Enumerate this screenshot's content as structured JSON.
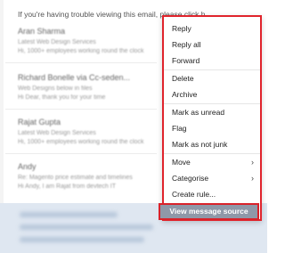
{
  "background": {
    "trouble_text": "If you're having trouble viewing this email, please click h",
    "emails": [
      {
        "from": "Aran Sharma",
        "lines": [
          "Latest Web Design Services",
          "Hi, 1000+ employees working round the clock"
        ]
      },
      {
        "from": "Richard Bonelle via Cc-seden...",
        "lines": [
          "Web Designs below in files",
          "Hi Dear, thank you for your time"
        ]
      },
      {
        "from": "Rajat Gupta",
        "lines": [
          "Latest Web Design Services",
          "Hi, 1000+ employees working round the clock"
        ]
      },
      {
        "from": "Andy",
        "lines": [
          "Re: Magento price estimate and timelines",
          "Hi Andy, I am Rajat from devtech IT"
        ]
      }
    ]
  },
  "menu": {
    "items": [
      {
        "label": "Reply",
        "submenu": false
      },
      {
        "label": "Reply all",
        "submenu": false
      },
      {
        "label": "Forward",
        "submenu": false
      },
      {
        "label": "Delete",
        "submenu": false
      },
      {
        "label": "Archive",
        "submenu": false
      },
      {
        "label": "Mark as unread",
        "submenu": false
      },
      {
        "label": "Flag",
        "submenu": false
      },
      {
        "label": "Mark as not junk",
        "submenu": false
      },
      {
        "label": "Move",
        "submenu": true
      },
      {
        "label": "Categorise",
        "submenu": true
      },
      {
        "label": "Create rule...",
        "submenu": false
      }
    ],
    "view_source_label": "View message source",
    "highlight_color": "#e0242c"
  },
  "icons": {
    "submenu": "chevron-right-icon"
  }
}
